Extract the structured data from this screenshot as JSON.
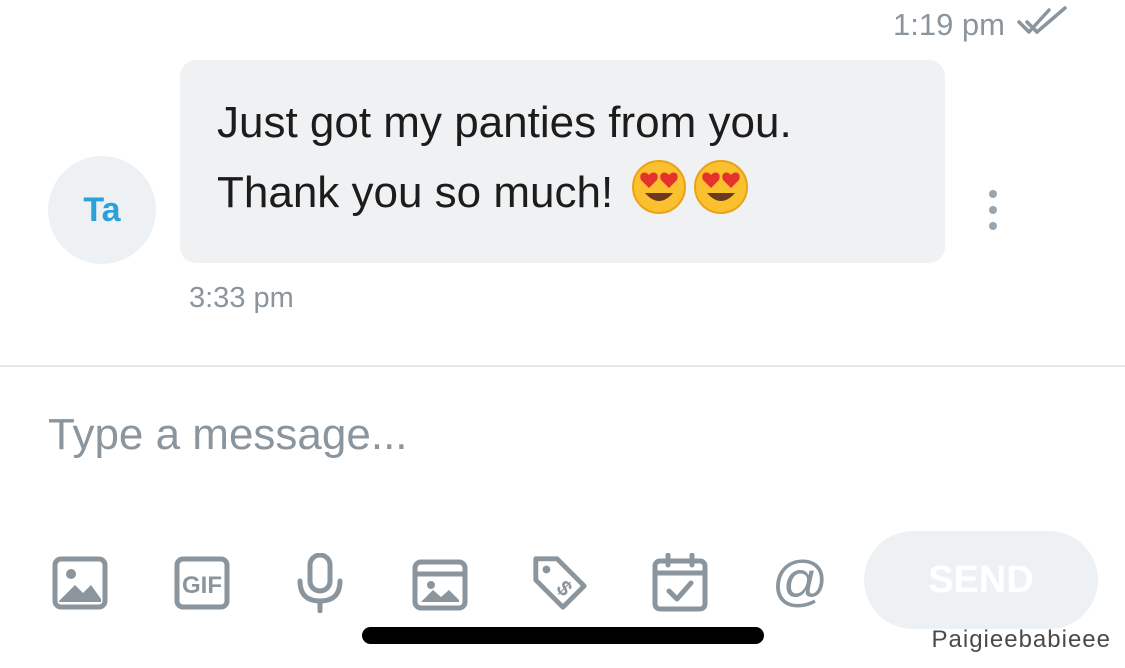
{
  "previous_message": {
    "time": "1:19 pm",
    "read_status_icon": "double-check-icon"
  },
  "contact": {
    "initials": "Ta"
  },
  "message": {
    "lines": [
      "Just got my panties from you.",
      "Thank you so much!"
    ],
    "emojis": [
      "heart-eyes-emoji",
      "heart-eyes-emoji"
    ],
    "time": "3:33 pm"
  },
  "composer": {
    "placeholder": "Type a message...",
    "value": ""
  },
  "toolbar": {
    "icons": [
      "image-icon",
      "gif-icon",
      "microphone-icon",
      "media-vault-icon",
      "price-tag-icon",
      "calendar-icon",
      "mention-icon"
    ],
    "gif_label": "GIF",
    "mention_label": "@",
    "send_label": "SEND"
  },
  "watermark": "Paigieebabieee",
  "colors": {
    "accent": "#2aa1d8",
    "muted": "#8a959e",
    "bubble": "#eff1f3",
    "icon": "#8a959e"
  }
}
